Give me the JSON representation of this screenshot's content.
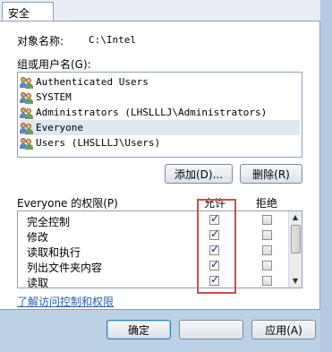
{
  "tabs": [
    "安全"
  ],
  "object": {
    "label": "对象名称:",
    "value": "C:\\Intel"
  },
  "group_section": {
    "label": "组或用户名(G):"
  },
  "users": [
    {
      "name": "Authenticated Users",
      "selected": false
    },
    {
      "name": "SYSTEM",
      "selected": false
    },
    {
      "name": "Administrators (LHSLLLJ\\Administrators)",
      "selected": false
    },
    {
      "name": "Everyone",
      "selected": true
    },
    {
      "name": "Users (LHSLLLJ\\Users)",
      "selected": false
    }
  ],
  "buttons": {
    "add": "添加(D)...",
    "remove": "删除(R)",
    "ok": "确定",
    "apply": "应用(A)"
  },
  "permissions_header": {
    "label": "Everyone 的权限(P)",
    "allow": "允许",
    "deny": "拒绝"
  },
  "permissions": [
    {
      "name": "完全控制",
      "allow": true,
      "deny": false
    },
    {
      "name": "修改",
      "allow": true,
      "deny": false
    },
    {
      "name": "读取和执行",
      "allow": true,
      "deny": false
    },
    {
      "name": "列出文件夹内容",
      "allow": true,
      "deny": false
    },
    {
      "name": "读取",
      "allow": true,
      "deny": false
    }
  ],
  "link_text": "了解访问控制和权限",
  "colors": {
    "highlight": "#d24a4a",
    "link": "#2f5fa8",
    "selection": "#dfe7f1"
  }
}
